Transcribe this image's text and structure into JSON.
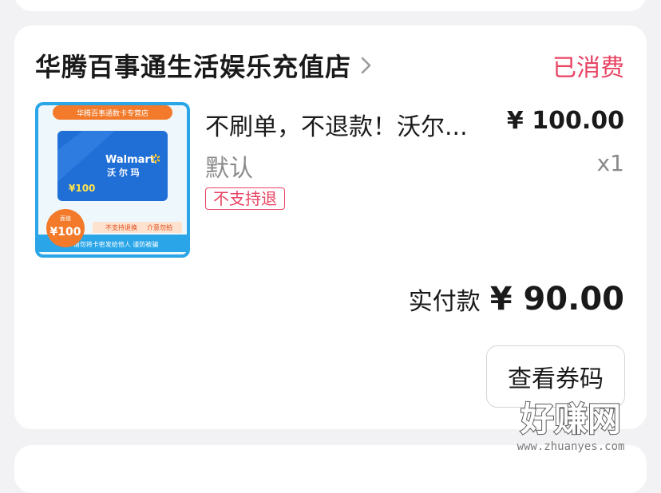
{
  "store": {
    "name": "华腾百事通生活娱乐充值店",
    "status": "已消费"
  },
  "product": {
    "title": "不刷单，不退款！沃尔...",
    "price": "¥ 100.00",
    "spec": "默认",
    "qty": "x1",
    "tag": "不支持退",
    "thumb": {
      "banner": "华腾百事通数卡专营店",
      "brand": "Walmart",
      "brand_cn": "沃 尔 玛",
      "card_value": "¥100",
      "badge_top": "面值",
      "badge_value": "¥100",
      "note1": "不支持退换",
      "note2": "介意勿拍",
      "note3": "请勿将卡密发给他人 谨防被骗",
      "colors": {
        "card": "#1f6fd6",
        "frame": "#2aa6e8",
        "badge": "#f27a2a"
      }
    }
  },
  "payment": {
    "label": "实付款",
    "amount": "¥ 90.00"
  },
  "actions": {
    "view_code": "查看券码"
  },
  "watermark": {
    "main": "好赚网",
    "url": "www.zhuanyes.com"
  },
  "colors": {
    "accent": "#e84363",
    "page_bg": "#f2f2f4",
    "card_bg": "#ffffff"
  },
  "icons": {
    "store_chevron": "chevron-right-icon",
    "walmart_spark": "walmart-spark-icon"
  }
}
